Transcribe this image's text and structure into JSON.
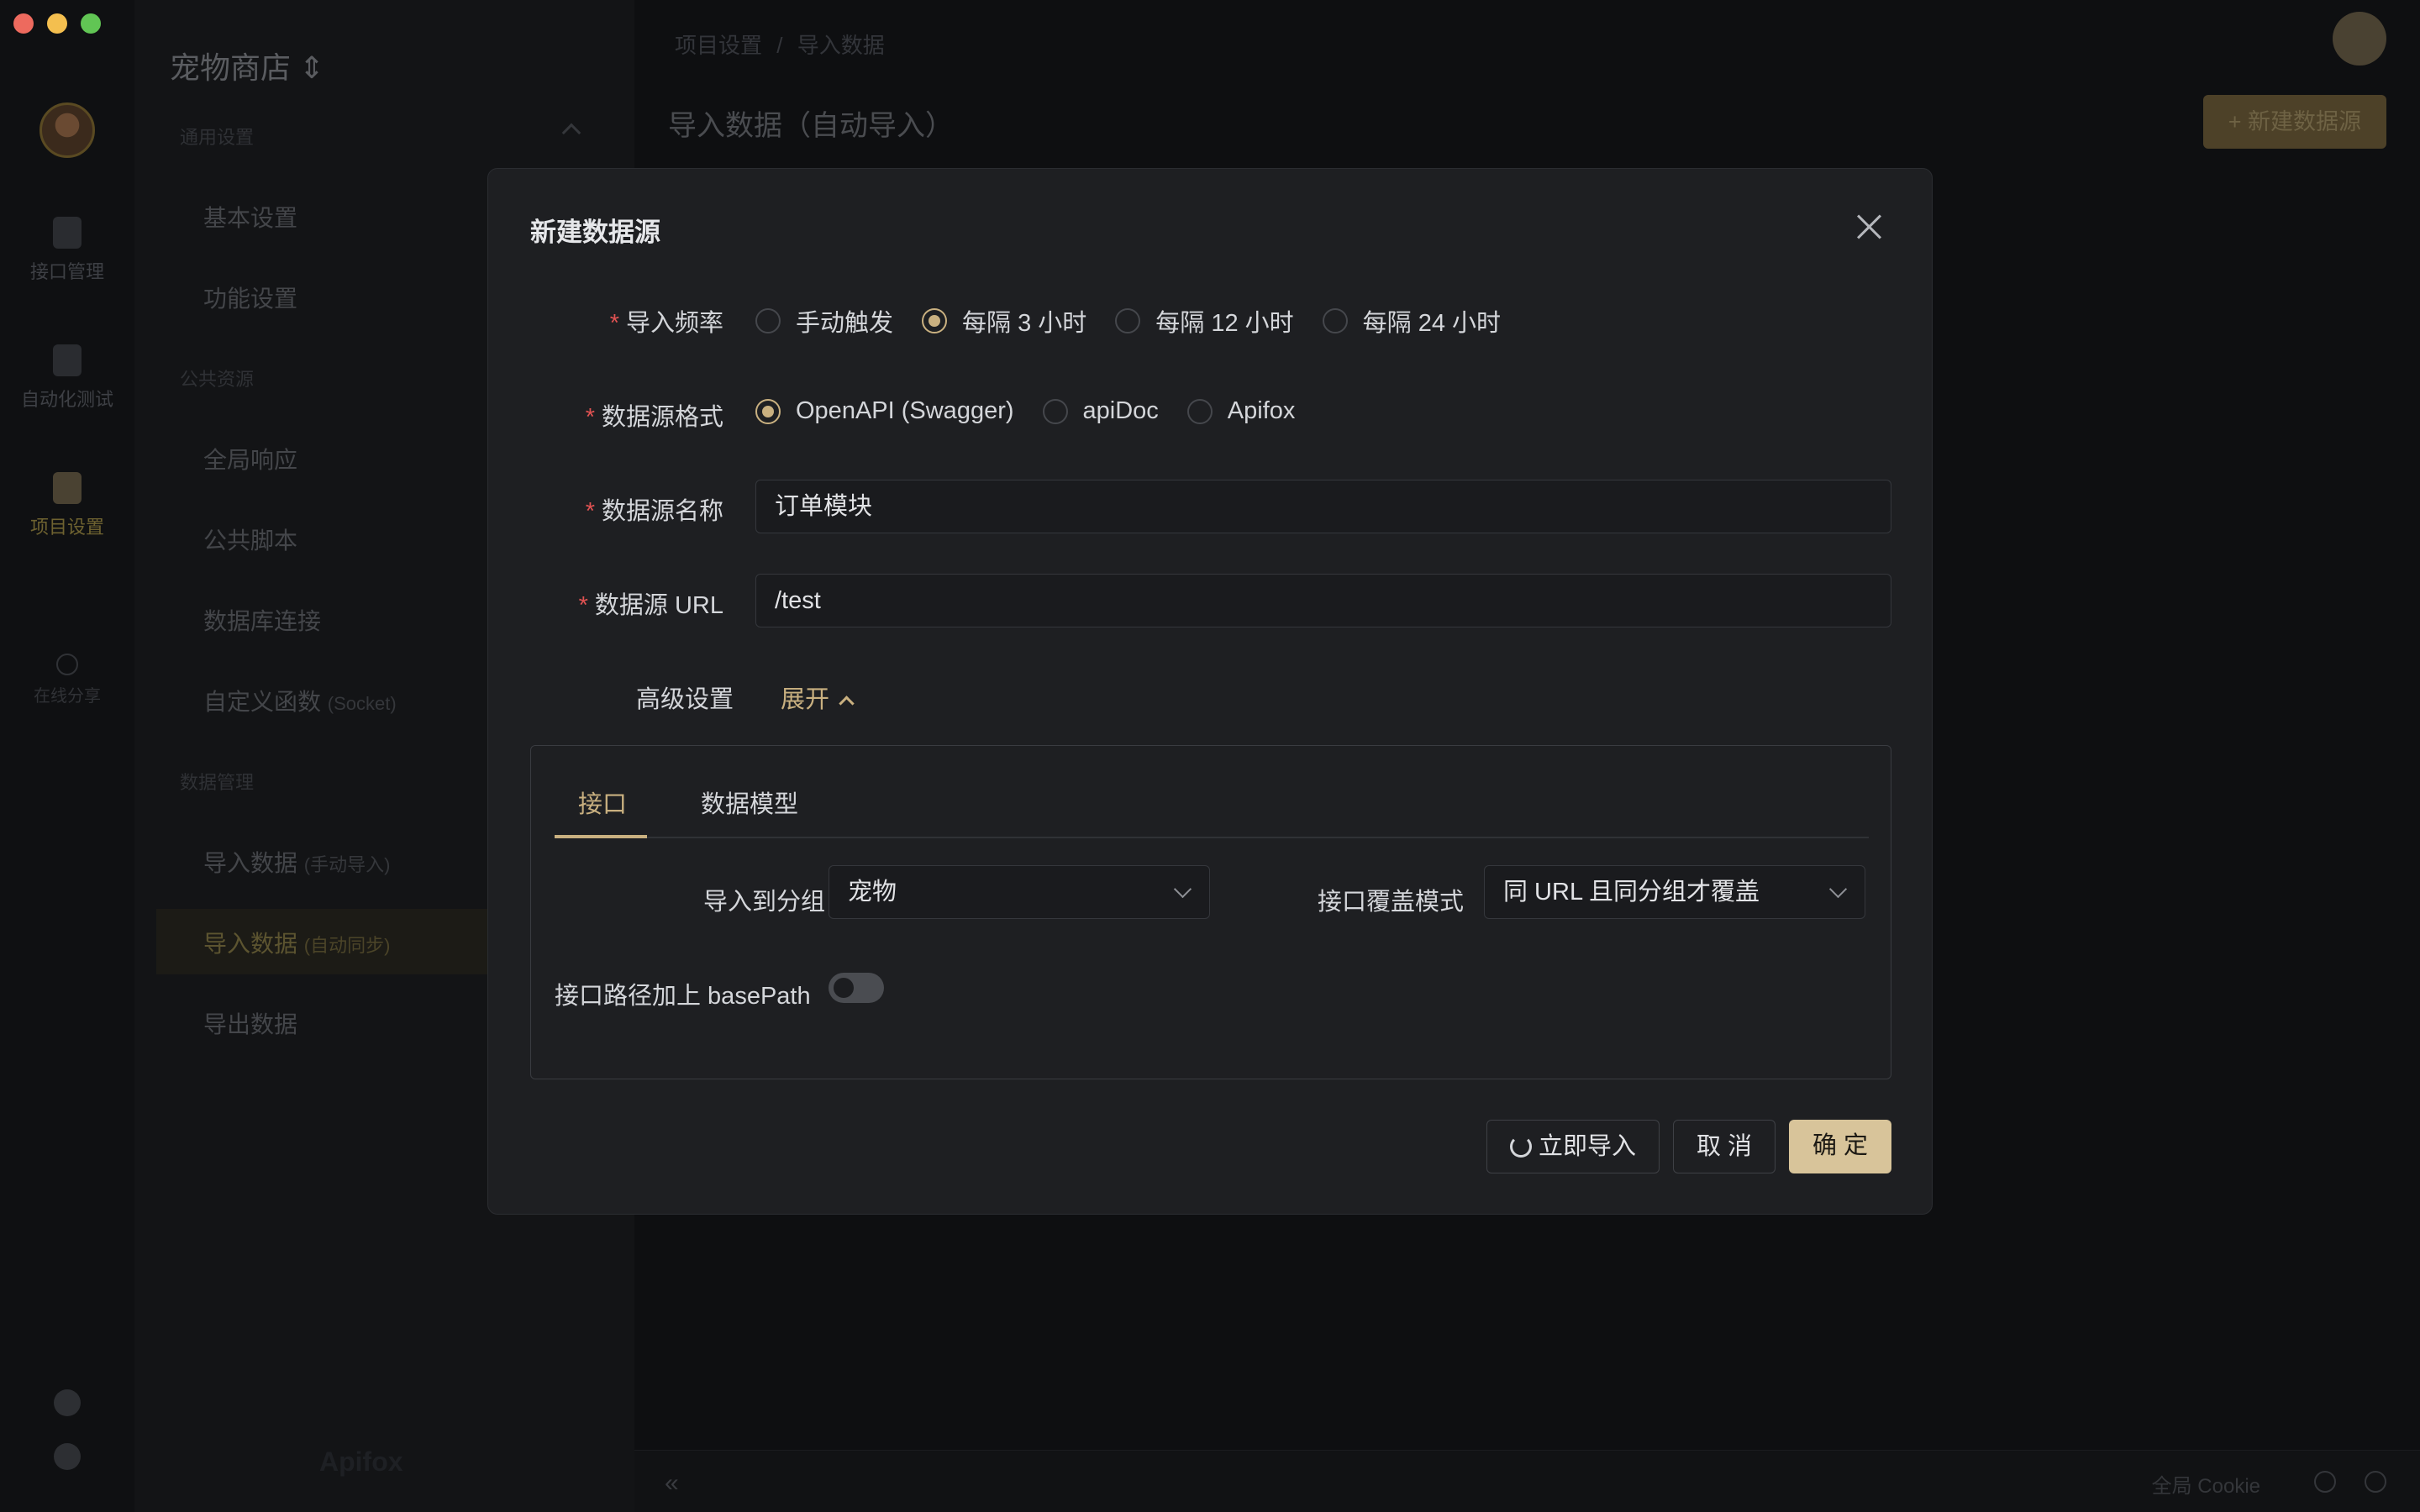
{
  "project": {
    "name": "宠物商店"
  },
  "rail": {
    "items": [
      "接口管理",
      "自动化测试",
      "项目设置"
    ],
    "share": "在线分享"
  },
  "sidebar": {
    "sections": [
      {
        "title": "通用设置",
        "items": [
          "基本设置",
          "功能设置"
        ]
      },
      {
        "title": "公共资源",
        "items": [
          "全局响应",
          "公共脚本",
          "数据库连接",
          "自定义函数"
        ]
      },
      {
        "title": "数据管理",
        "items": [
          "导入数据",
          "导入数据",
          "导出数据"
        ]
      }
    ],
    "custom_func_suffix": "(Socket)",
    "import_manual_suffix": "(手动导入)",
    "import_auto_suffix": "(自动同步)",
    "brand": "Apifox"
  },
  "main": {
    "breadcrumb": [
      "项目设置",
      "/",
      "导入数据"
    ],
    "title": "导入数据（自动导入）",
    "new_source_button": "+ 新建数据源"
  },
  "statusbar": {
    "cookie": "全局 Cookie"
  },
  "modal": {
    "title": "新建数据源",
    "frequency": {
      "label": "导入频率",
      "options": [
        "手动触发",
        "每隔 3 小时",
        "每隔 12 小时",
        "每隔 24 小时"
      ],
      "selected": "每隔 3 小时"
    },
    "format": {
      "label": "数据源格式",
      "options": [
        "OpenAPI (Swagger)",
        "apiDoc",
        "Apifox"
      ],
      "selected": "OpenAPI (Swagger)"
    },
    "name": {
      "label": "数据源名称",
      "value": "订单模块"
    },
    "url": {
      "label": "数据源 URL",
      "value": "/test"
    },
    "advanced": {
      "label": "高级设置",
      "toggle": "展开"
    },
    "tabs": [
      "接口",
      "数据模型"
    ],
    "import_group": {
      "label": "导入到分组",
      "value": "宠物"
    },
    "overwrite": {
      "label": "接口覆盖模式",
      "value": "同 URL 且同分组才覆盖"
    },
    "basepath": {
      "label": "接口路径加上 basePath",
      "enabled": false
    },
    "buttons": {
      "import_now": "立即导入",
      "cancel": "取 消",
      "confirm": "确 定"
    }
  },
  "colors": {
    "accent": "#c9b080",
    "required": "#e05252",
    "primary_button": "#d8c49a"
  }
}
